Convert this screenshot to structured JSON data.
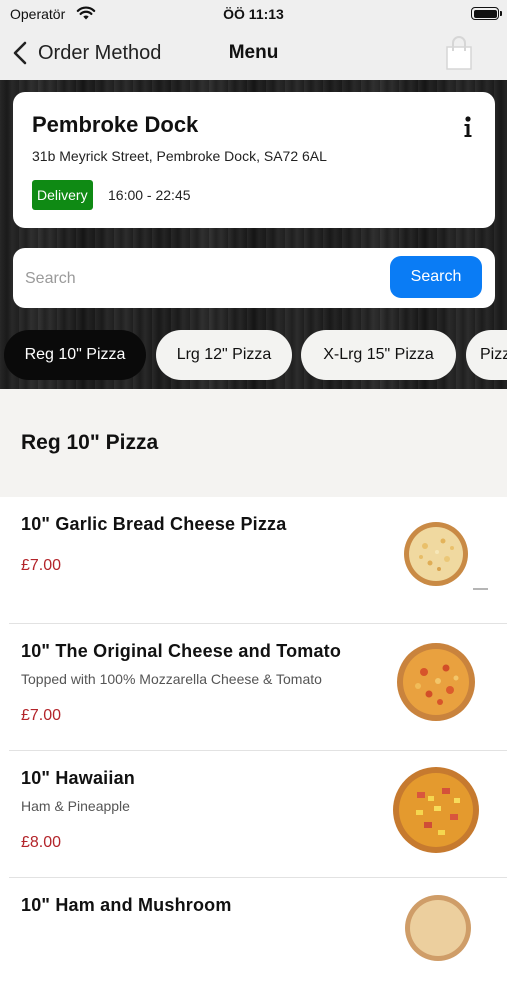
{
  "status_bar": {
    "carrier": "Operatör",
    "time": "ÖÖ 11:13"
  },
  "nav": {
    "back_label": "Order Method",
    "title": "Menu"
  },
  "store": {
    "name": "Pembroke Dock",
    "address": "31b Meyrick Street, Pembroke Dock, SA72 6AL",
    "badge": "Delivery",
    "badge_color": "#0f8a14",
    "hours": "16:00 - 22:45"
  },
  "search": {
    "placeholder": "Search",
    "button_label": "Search",
    "button_color": "#0a7cf5"
  },
  "tabs": [
    {
      "label": "Reg 10\" Pizza",
      "active": true
    },
    {
      "label": "Lrg 12\" Pizza",
      "active": false
    },
    {
      "label": "X-Lrg 15\" Pizza",
      "active": false
    },
    {
      "label": "Pizz",
      "active": false
    }
  ],
  "section": {
    "title": "Reg 10\" Pizza"
  },
  "items": [
    {
      "name": "10\" Garlic Bread Cheese Pizza",
      "description": "",
      "price": "£7.00",
      "image_icon": "garlic-bread-pizza-image"
    },
    {
      "name": "10\" The Original Cheese and Tomato",
      "description": "Topped with 100% Mozzarella Cheese & Tomato",
      "price": "£7.00",
      "image_icon": "cheese-tomato-pizza-image"
    },
    {
      "name": "10\" Hawaiian",
      "description": "Ham & Pineapple",
      "price": "£8.00",
      "image_icon": "hawaiian-pizza-image"
    },
    {
      "name": "10\" Ham and Mushroom",
      "description": "",
      "price": "",
      "image_icon": "pizza-image"
    }
  ],
  "colors": {
    "price": "#b3242a",
    "active_tab": "#0a0a0a"
  }
}
